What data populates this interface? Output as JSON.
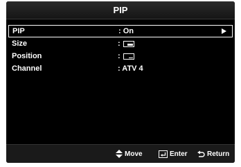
{
  "window": {
    "title": "PIP"
  },
  "menu": {
    "items": [
      {
        "label": "PIP",
        "value": ": On",
        "selected": true,
        "has_arrow": true
      },
      {
        "label": "Size",
        "value": ":",
        "icon": "pip-size-icon"
      },
      {
        "label": "Position",
        "value": ":",
        "icon": "pip-position-icon"
      },
      {
        "label": "Channel",
        "value": ": ATV 4"
      }
    ]
  },
  "footer": {
    "move_label": "Move",
    "move_icon": "up-down-arrows-icon",
    "enter_label": "Enter",
    "enter_icon": "enter-icon",
    "return_label": "Return",
    "return_icon": "return-arrow-icon"
  },
  "colors": {
    "background": "#000000",
    "title_bar": "#222222",
    "text": "#ffffff",
    "selection_border": "#ffffff"
  }
}
